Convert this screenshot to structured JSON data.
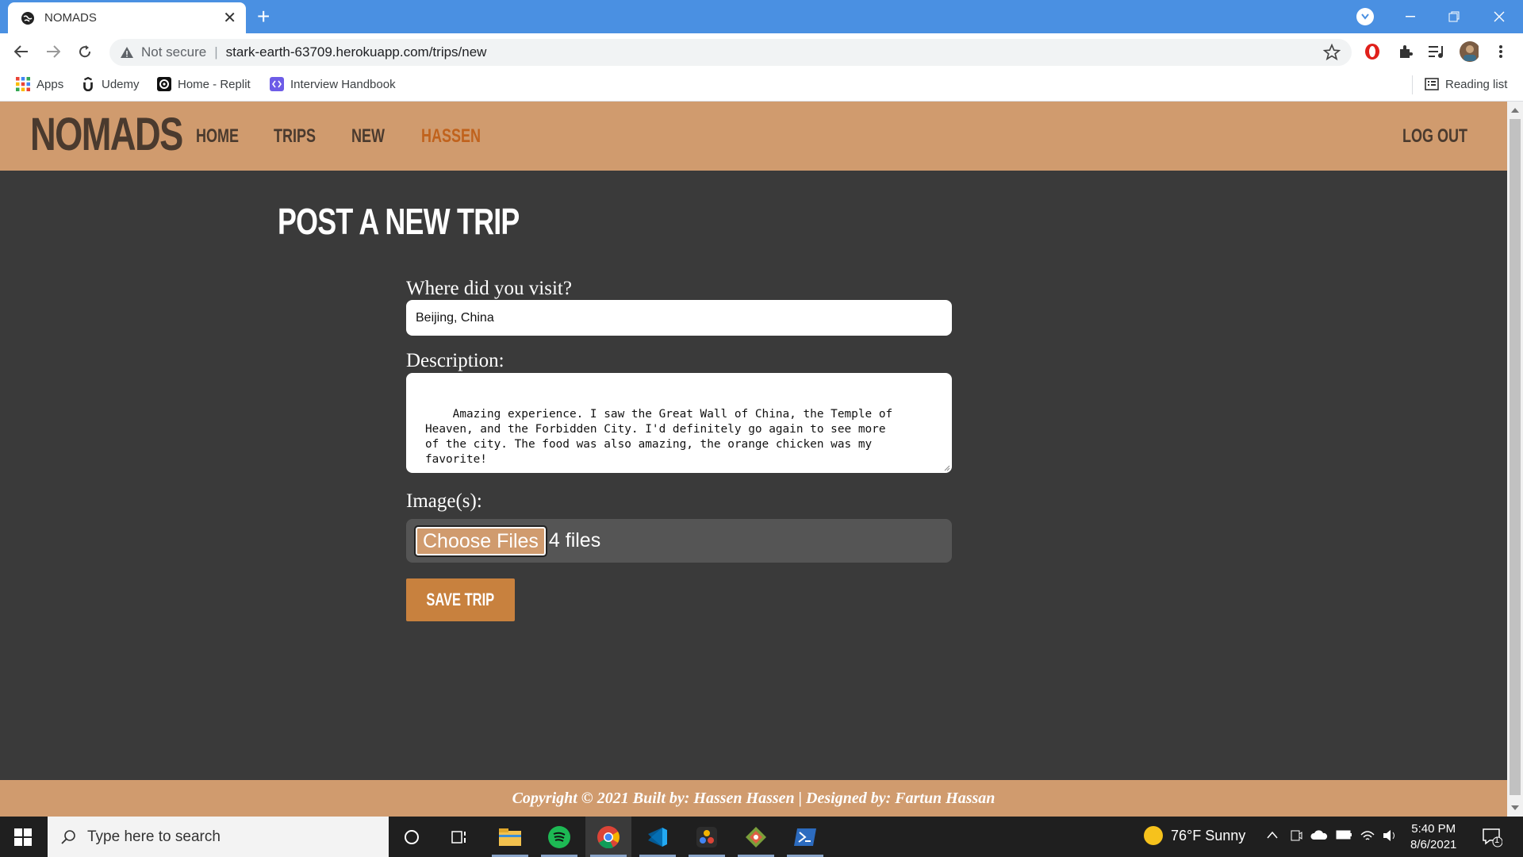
{
  "browser": {
    "tab_title": "NOMADS",
    "tab_close": "✕",
    "new_tab": "+",
    "not_secure": "Not secure",
    "url": "stark-earth-63709.herokuapp.com/trips/new",
    "bookmarks": [
      "Apps",
      "Udemy",
      "Home - Replit",
      "Interview Handbook"
    ],
    "reading_list": "Reading list"
  },
  "site": {
    "brand": "NOMADS",
    "nav": [
      "HOME",
      "TRIPS",
      "NEW",
      "HASSEN"
    ],
    "active_nav": "HASSEN",
    "logout": "LOG OUT"
  },
  "form": {
    "title": "POST A NEW TRIP",
    "location_label": "Where did you visit?",
    "location_value": "Beijing, China",
    "description_label": "Description:",
    "description_value": "Amazing experience. I saw the Great Wall of China, the Temple of\nHeaven, and the Forbidden City. I'd definitely go again to see more\nof the city. The food was also amazing, the orange chicken was my\nfavorite!",
    "images_label": "Image(s):",
    "choose_files": "Choose Files",
    "file_count": "4 files",
    "save_button": "SAVE TRIP"
  },
  "footer": {
    "text": "Copyright © 2021 Built by: Hassen Hassen | Designed by: Fartun Hassan"
  },
  "taskbar": {
    "search_placeholder": "Type here to search",
    "weather": "76°F  Sunny",
    "time": "5:40 PM",
    "date": "8/6/2021",
    "notifications": "1"
  },
  "colors": {
    "nav_bg": "#d09b6e",
    "page_bg": "#3a3a3a",
    "accent": "#c0621c",
    "button": "#c8813e"
  }
}
